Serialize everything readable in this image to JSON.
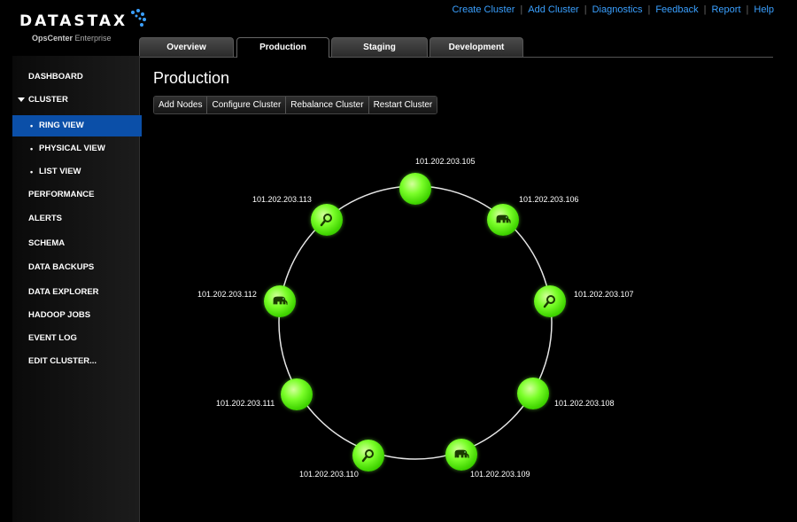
{
  "brand": {
    "name": "DATASTAX",
    "product": "OpsCenter",
    "edition": "Enterprise"
  },
  "toplinks": [
    "Create Cluster",
    "Add Cluster",
    "Diagnostics",
    "Feedback",
    "Report",
    "Help"
  ],
  "tabs": [
    "Overview",
    "Production",
    "Staging",
    "Development"
  ],
  "active_tab": "Production",
  "sidebar": {
    "items": [
      "DASHBOARD",
      "CLUSTER",
      "RING VIEW",
      "PHYSICAL VIEW",
      "LIST VIEW",
      "PERFORMANCE",
      "ALERTS",
      "SCHEMA",
      "DATA BACKUPS",
      "DATA EXPLORER",
      "HADOOP JOBS",
      "EVENT LOG",
      "EDIT CLUSTER..."
    ],
    "active": "RING VIEW"
  },
  "page_title": "Production",
  "toolbar": [
    "Add Nodes",
    "Configure Cluster",
    "Rebalance Cluster",
    "Restart Cluster"
  ],
  "nodes": [
    {
      "ip": "101.202.203.105",
      "icon": "none"
    },
    {
      "ip": "101.202.203.106",
      "icon": "elephant-icon"
    },
    {
      "ip": "101.202.203.107",
      "icon": "magnifier-icon"
    },
    {
      "ip": "101.202.203.108",
      "icon": "none"
    },
    {
      "ip": "101.202.203.109",
      "icon": "elephant-icon"
    },
    {
      "ip": "101.202.203.110",
      "icon": "magnifier-icon"
    },
    {
      "ip": "101.202.203.111",
      "icon": "none"
    },
    {
      "ip": "101.202.203.112",
      "icon": "elephant-icon"
    },
    {
      "ip": "101.202.203.113",
      "icon": "magnifier-icon"
    }
  ],
  "colors": {
    "accent": "#3aa0ff",
    "active_nav": "#0b4fa8",
    "node_green": "#5cff1a"
  }
}
